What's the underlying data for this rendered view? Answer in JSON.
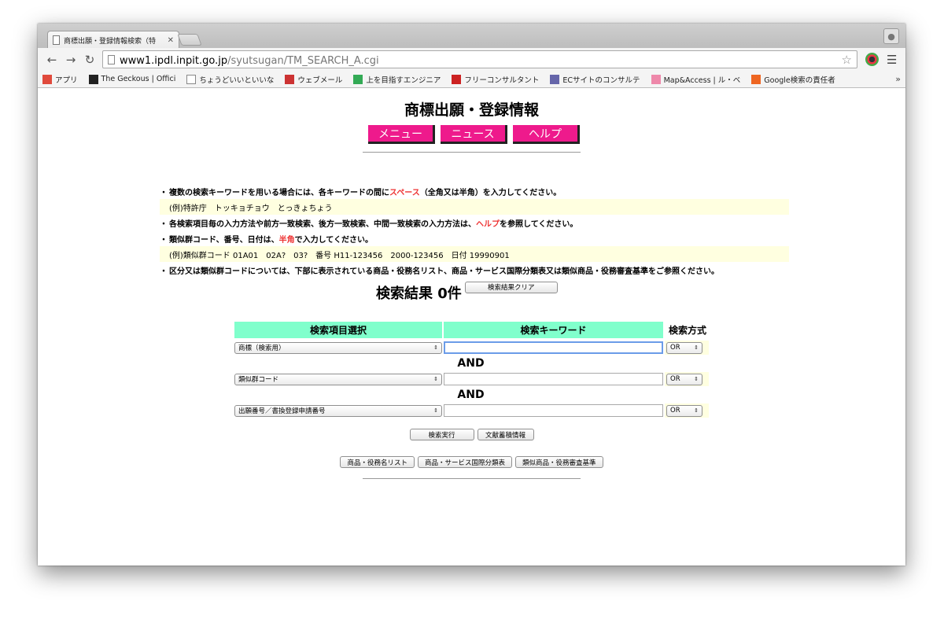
{
  "browser": {
    "tab_title": "商標出願・登録情報検索（特",
    "url_host": "www1.ipdl.inpit.go.jp",
    "url_path": "/syutsugan/TM_SEARCH_A.cgi",
    "bookmarks": [
      {
        "label": "アプリ",
        "icon": "apps-icon",
        "color": "#e04a3c"
      },
      {
        "label": "The Geckous | Offici",
        "icon": "geckous-icon",
        "color": "#222222"
      },
      {
        "label": "ちょうどいいといいな",
        "icon": "page-icon",
        "color": "#ffffff"
      },
      {
        "label": "ウェブメール",
        "icon": "webmail-icon",
        "color": "#cc3333"
      },
      {
        "label": "上を目指すエンジニア",
        "icon": "at-icon",
        "color": "#33aa55"
      },
      {
        "label": "フリーコンサルタント",
        "icon": "square-icon",
        "color": "#cc2222"
      },
      {
        "label": "ECサイトのコンサルテ",
        "icon": "feather-icon",
        "color": "#6666aa"
      },
      {
        "label": "Map&Access | ル・ベ",
        "icon": "heart-icon",
        "color": "#ee88aa"
      },
      {
        "label": "Google検索の責任者",
        "icon": "w-icon",
        "color": "#ee6622"
      }
    ],
    "more": "»"
  },
  "page": {
    "title": "商標出願・登録情報",
    "nav": [
      "メニュー",
      "ニュース",
      "ヘルプ"
    ],
    "notes": {
      "n1_a": "複数の検索キーワードを用いる場合には、各キーワードの間に",
      "n1_red": "スペース",
      "n1_b": "（全角又は半角）を入力してください。",
      "ex1": "(例)特許庁　トッキョチョウ　とっきょちょう",
      "n2_a": "各検索項目毎の入力方法や前方一致検索、後方一致検索、中間一致検索の入力方法は、",
      "n2_red": "ヘルプ",
      "n2_b": "を参照してください。",
      "n3_a": "類似群コード、番号、日付は、",
      "n3_red": "半角",
      "n3_b": "で入力してください。",
      "ex2": "(例)類似群コード 01A01　02A?　03?　番号 H11-123456　2000-123456　日付 19990901",
      "n4": "区分又は類似群コードについては、下部に表示されている商品・役務名リスト、商品・サービス国際分類表又は類似商品・役務審査基準をご参照ください。"
    },
    "result_label": "検索結果 0件",
    "clear_button": "検索結果クリア",
    "table": {
      "headers": [
        "検索項目選択",
        "検索キーワード",
        "検索方式"
      ],
      "rows": [
        {
          "field": "商標（検索用）",
          "keyword": "",
          "mode": "OR"
        },
        {
          "field": "類似群コード",
          "keyword": "",
          "mode": "OR"
        },
        {
          "field": "出願番号／書換登録申請番号",
          "keyword": "",
          "mode": "OR"
        }
      ],
      "connector": "AND"
    },
    "search_button": "検索実行",
    "doc_button": "文献蓄積情報",
    "bottom_buttons": [
      "商品・役務名リスト",
      "商品・サービス国際分類表",
      "類似商品・役務審査基準"
    ]
  }
}
